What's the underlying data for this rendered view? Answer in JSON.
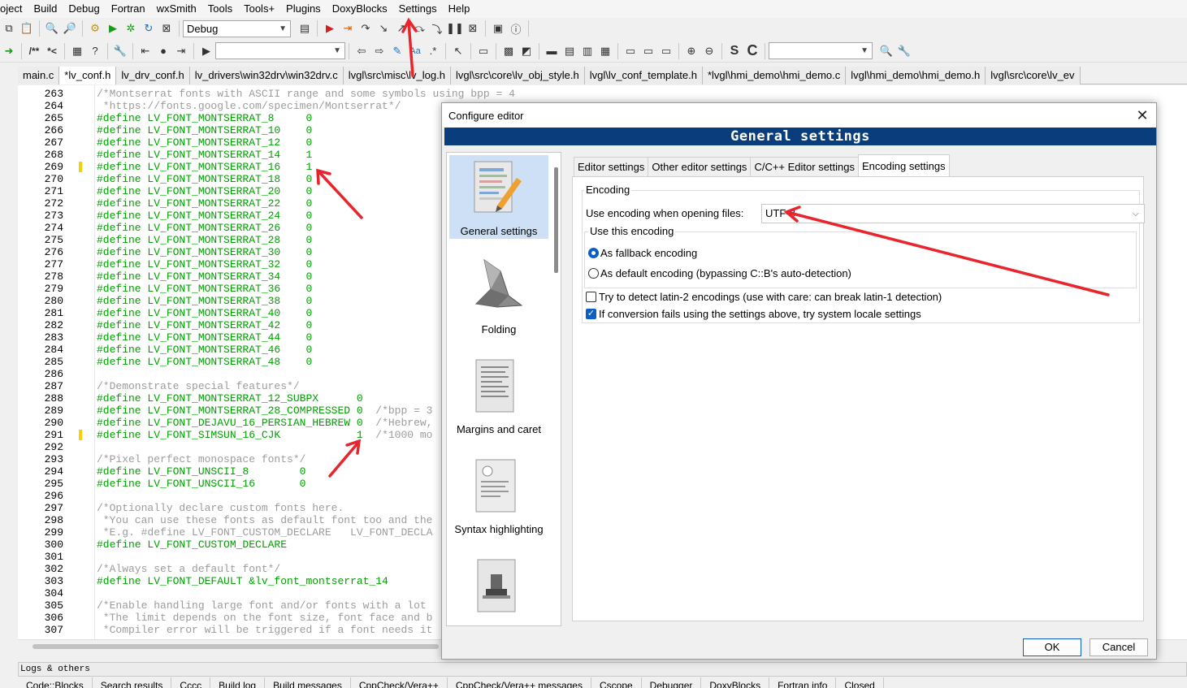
{
  "menu": [
    "oject",
    "Build",
    "Debug",
    "Fortran",
    "wxSmith",
    "Tools",
    "Tools+",
    "Plugins",
    "DoxyBlocks",
    "Settings",
    "Help"
  ],
  "toolbar": {
    "build_target": "Debug",
    "combo2": "",
    "combo3": "",
    "toggle_s": "S",
    "toggle_c": "C"
  },
  "tabs": [
    {
      "label": "main.c",
      "active": false
    },
    {
      "label": "*lv_conf.h",
      "active": true
    },
    {
      "label": "lv_drv_conf.h",
      "active": false
    },
    {
      "label": "lv_drivers\\win32drv\\win32drv.c",
      "active": false
    },
    {
      "label": "lvgl\\src\\misc\\lv_log.h",
      "active": false
    },
    {
      "label": "lvgl\\src\\core\\lv_obj_style.h",
      "active": false
    },
    {
      "label": "lvgl\\lv_conf_template.h",
      "active": false
    },
    {
      "label": "*lvgl\\hmi_demo\\hmi_demo.c",
      "active": false
    },
    {
      "label": "lvgl\\hmi_demo\\hmi_demo.h",
      "active": false
    },
    {
      "label": "lvgl\\src\\core\\lv_ev",
      "active": false
    }
  ],
  "editor": {
    "lines": [
      {
        "n": "263",
        "text": "/*Montserrat fonts with ASCII range and some symbols using bpp = 4",
        "comment": true
      },
      {
        "n": "264",
        "text": " *https://fonts.google.com/specimen/Montserrat*/",
        "comment": true
      },
      {
        "n": "265",
        "text": "#define LV_FONT_MONTSERRAT_8     0"
      },
      {
        "n": "266",
        "text": "#define LV_FONT_MONTSERRAT_10    0"
      },
      {
        "n": "267",
        "text": "#define LV_FONT_MONTSERRAT_12    0"
      },
      {
        "n": "268",
        "text": "#define LV_FONT_MONTSERRAT_14    1"
      },
      {
        "n": "269",
        "text": "#define LV_FONT_MONTSERRAT_16    1",
        "marker": true
      },
      {
        "n": "270",
        "text": "#define LV_FONT_MONTSERRAT_18    0"
      },
      {
        "n": "271",
        "text": "#define LV_FONT_MONTSERRAT_20    0"
      },
      {
        "n": "272",
        "text": "#define LV_FONT_MONTSERRAT_22    0"
      },
      {
        "n": "273",
        "text": "#define LV_FONT_MONTSERRAT_24    0"
      },
      {
        "n": "274",
        "text": "#define LV_FONT_MONTSERRAT_26    0"
      },
      {
        "n": "275",
        "text": "#define LV_FONT_MONTSERRAT_28    0"
      },
      {
        "n": "276",
        "text": "#define LV_FONT_MONTSERRAT_30    0"
      },
      {
        "n": "277",
        "text": "#define LV_FONT_MONTSERRAT_32    0"
      },
      {
        "n": "278",
        "text": "#define LV_FONT_MONTSERRAT_34    0"
      },
      {
        "n": "279",
        "text": "#define LV_FONT_MONTSERRAT_36    0"
      },
      {
        "n": "280",
        "text": "#define LV_FONT_MONTSERRAT_38    0"
      },
      {
        "n": "281",
        "text": "#define LV_FONT_MONTSERRAT_40    0"
      },
      {
        "n": "282",
        "text": "#define LV_FONT_MONTSERRAT_42    0"
      },
      {
        "n": "283",
        "text": "#define LV_FONT_MONTSERRAT_44    0"
      },
      {
        "n": "284",
        "text": "#define LV_FONT_MONTSERRAT_46    0"
      },
      {
        "n": "285",
        "text": "#define LV_FONT_MONTSERRAT_48    0"
      },
      {
        "n": "286",
        "text": ""
      },
      {
        "n": "287",
        "text": "/*Demonstrate special features*/",
        "comment": true
      },
      {
        "n": "288",
        "text": "#define LV_FONT_MONTSERRAT_12_SUBPX      0"
      },
      {
        "n": "289",
        "text": "#define LV_FONT_MONTSERRAT_28_COMPRESSED 0  /*bpp = 3",
        "tail_comment_at": 35
      },
      {
        "n": "290",
        "text": "#define LV_FONT_DEJAVU_16_PERSIAN_HEBREW 0  /*Hebrew,",
        "tail_comment_at": 35
      },
      {
        "n": "291",
        "text": "#define LV_FONT_SIMSUN_16_CJK            1  /*1000 mo",
        "tail_comment_at": 35,
        "marker": true
      },
      {
        "n": "292",
        "text": ""
      },
      {
        "n": "293",
        "text": "/*Pixel perfect monospace fonts*/",
        "comment": true
      },
      {
        "n": "294",
        "text": "#define LV_FONT_UNSCII_8        0"
      },
      {
        "n": "295",
        "text": "#define LV_FONT_UNSCII_16       0"
      },
      {
        "n": "296",
        "text": ""
      },
      {
        "n": "297",
        "text": "/*Optionally declare custom fonts here.",
        "comment": true
      },
      {
        "n": "298",
        "text": " *You can use these fonts as default font too and the",
        "comment": true
      },
      {
        "n": "299",
        "text": " *E.g. #define LV_FONT_CUSTOM_DECLARE   LV_FONT_DECLA",
        "comment": true
      },
      {
        "n": "300",
        "text": "#define LV_FONT_CUSTOM_DECLARE"
      },
      {
        "n": "301",
        "text": ""
      },
      {
        "n": "302",
        "text": "/*Always set a default font*/",
        "comment": true
      },
      {
        "n": "303",
        "text": "#define LV_FONT_DEFAULT &lv_font_montserrat_14"
      },
      {
        "n": "304",
        "text": ""
      },
      {
        "n": "305",
        "text": "/*Enable handling large font and/or fonts with a lot",
        "comment": true
      },
      {
        "n": "306",
        "text": " *The limit depends on the font size, font face and b",
        "comment": true
      },
      {
        "n": "307",
        "text": " *Compiler error will be triggered if a font needs it",
        "comment": true
      }
    ]
  },
  "bottom": {
    "logs_title": "Logs & others",
    "tabs": [
      "Code::Blocks",
      "Search results",
      "Cccc",
      "Build log",
      "Build messages",
      "CppCheck/Vera++",
      "CppCheck/Vera++ messages",
      "Cscope",
      "Debugger",
      "DoxyBlocks",
      "Fortran info",
      "Closed"
    ]
  },
  "dialog": {
    "title": "Configure editor",
    "header": "General settings",
    "categories": [
      "General settings",
      "Folding",
      "Margins and caret",
      "Syntax highlighting",
      ""
    ],
    "tabs": [
      "Editor settings",
      "Other editor settings",
      "C/C++ Editor settings",
      "Encoding settings"
    ],
    "active_tab": "Encoding settings",
    "encoding": {
      "group_title": "Encoding",
      "open_label": "Use encoding when opening files:",
      "open_value": "UTF-8",
      "use_group_title": "Use this encoding",
      "radio_fallback": "As fallback encoding",
      "radio_default": "As default encoding (bypassing C::B's auto-detection)",
      "fallback_selected": true,
      "check_latin2": "Try to detect latin-2 encodings (use with care: can break latin-1 detection)",
      "check_latin2_checked": false,
      "check_locale": "If conversion fails using the settings above, try system locale settings",
      "check_locale_checked": true
    },
    "ok": "OK",
    "cancel": "Cancel"
  },
  "colors": {
    "header_bg": "#0a3d7c",
    "code_green": "#00a000",
    "comment_gray": "#9c9c9c",
    "annotation_red": "#e8242c",
    "accent_blue": "#0a5ec4"
  }
}
